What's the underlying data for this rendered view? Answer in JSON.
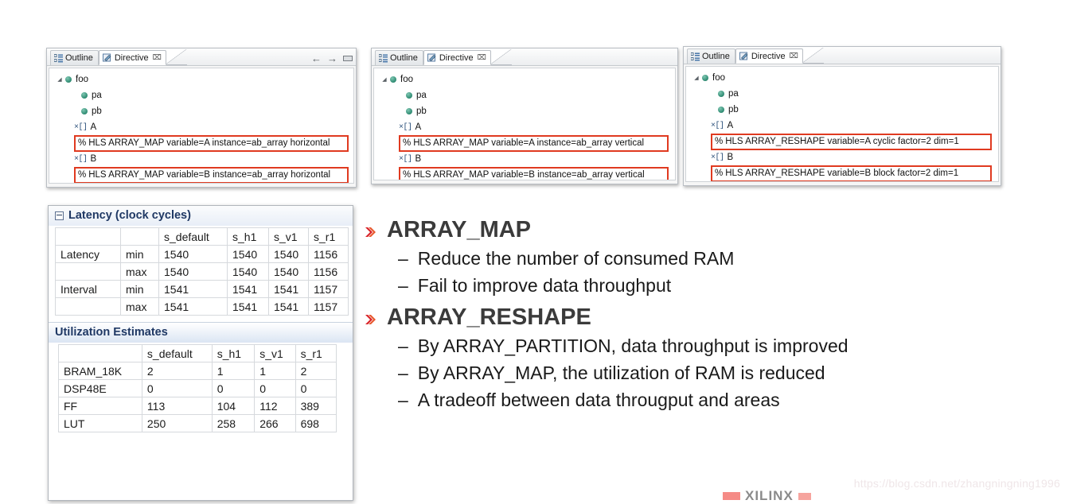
{
  "panels": [
    {
      "id": "panel-horizontal",
      "tabs": [
        {
          "label": "Outline",
          "icon": "outline-icon",
          "active": false
        },
        {
          "label": "Directive",
          "icon": "directive-icon",
          "active": true,
          "close": "⌧"
        }
      ],
      "tools": {
        "back": "←",
        "forward": "→",
        "minimize": "minimize-icon"
      },
      "show_tools": true,
      "tree": [
        {
          "type": "root",
          "label": "foo",
          "icon": "green-dot-icon",
          "twist": "◢"
        },
        {
          "type": "child",
          "label": "pa",
          "icon": "green-dot-icon"
        },
        {
          "type": "child",
          "label": "pb",
          "icon": "green-dot-icon"
        },
        {
          "type": "array",
          "label": "A",
          "icon": "array-icon"
        },
        {
          "type": "directive",
          "label": "HLS ARRAY_MAP variable=A instance=ab_array horizontal",
          "prefix": "%"
        },
        {
          "type": "array",
          "label": "B",
          "icon": "array-icon"
        },
        {
          "type": "directive",
          "label": "HLS ARRAY_MAP variable=B instance=ab_array horizontal",
          "prefix": "%"
        }
      ]
    },
    {
      "id": "panel-vertical",
      "tabs": [
        {
          "label": "Outline",
          "icon": "outline-icon",
          "active": false
        },
        {
          "label": "Directive",
          "icon": "directive-icon",
          "active": true,
          "close": "⌧"
        }
      ],
      "tools": {
        "back": "←",
        "forward": "→",
        "minimize": "minimize-icon"
      },
      "show_tools": false,
      "tree": [
        {
          "type": "root",
          "label": "foo",
          "icon": "green-dot-icon",
          "twist": "◢"
        },
        {
          "type": "child",
          "label": "pa",
          "icon": "green-dot-icon"
        },
        {
          "type": "child",
          "label": "pb",
          "icon": "green-dot-icon"
        },
        {
          "type": "array",
          "label": "A",
          "icon": "array-icon"
        },
        {
          "type": "directive",
          "label": "HLS ARRAY_MAP variable=A instance=ab_array vertical",
          "prefix": "%"
        },
        {
          "type": "array",
          "label": "B",
          "icon": "array-icon"
        },
        {
          "type": "directive",
          "label": "HLS ARRAY_MAP variable=B instance=ab_array vertical",
          "prefix": "%"
        }
      ]
    },
    {
      "id": "panel-reshape",
      "tabs": [
        {
          "label": "Outline",
          "icon": "outline-icon",
          "active": false
        },
        {
          "label": "Directive",
          "icon": "directive-icon",
          "active": true,
          "close": "⌧"
        }
      ],
      "tools": {
        "back": "←",
        "forward": "→",
        "minimize": "minimize-icon"
      },
      "show_tools": false,
      "tree": [
        {
          "type": "root",
          "label": "foo",
          "icon": "green-dot-icon",
          "twist": "◢"
        },
        {
          "type": "child",
          "label": "pa",
          "icon": "green-dot-icon"
        },
        {
          "type": "child",
          "label": "pb",
          "icon": "green-dot-icon"
        },
        {
          "type": "array",
          "label": "A",
          "icon": "array-icon"
        },
        {
          "type": "directive",
          "label": "HLS ARRAY_RESHAPE variable=A cyclic factor=2 dim=1",
          "prefix": "%"
        },
        {
          "type": "array",
          "label": "B",
          "icon": "array-icon"
        },
        {
          "type": "directive",
          "label": "HLS ARRAY_RESHAPE variable=B block factor=2 dim=1",
          "prefix": "%"
        }
      ]
    }
  ],
  "report": {
    "latency": {
      "title": "Latency (clock cycles)",
      "columns": [
        "",
        "",
        "s_default",
        "s_h1",
        "s_v1",
        "s_r1"
      ],
      "rows": [
        [
          "Latency",
          "min",
          "1540",
          "1540",
          "1540",
          "1156"
        ],
        [
          "",
          "max",
          "1540",
          "1540",
          "1540",
          "1156"
        ],
        [
          "Interval",
          "min",
          "1541",
          "1541",
          "1541",
          "1157"
        ],
        [
          "",
          "max",
          "1541",
          "1541",
          "1541",
          "1157"
        ]
      ]
    },
    "utilization": {
      "title": "Utilization Estimates",
      "columns": [
        "",
        "s_default",
        "s_h1",
        "s_v1",
        "s_r1"
      ],
      "rows": [
        [
          "BRAM_18K",
          "2",
          "1",
          "1",
          "2"
        ],
        [
          "DSP48E",
          "0",
          "0",
          "0",
          "0"
        ],
        [
          "FF",
          "113",
          "104",
          "112",
          "389"
        ],
        [
          "LUT",
          "250",
          "258",
          "266",
          "698"
        ]
      ]
    }
  },
  "bullets": [
    {
      "title": "ARRAY_MAP",
      "items": [
        "Reduce the number of consumed RAM",
        "Fail to improve data throughput"
      ]
    },
    {
      "title": "ARRAY_RESHAPE",
      "items": [
        "By ARRAY_PARTITION, data throughput is improved",
        "By ARRAY_MAP, the utilization of RAM is reduced",
        "A tradeoff between data througput and areas"
      ]
    }
  ],
  "watermark": "https://blog.csdn.net/zhangningning1996",
  "logo": {
    "text": "XILINX"
  },
  "colors": {
    "accent_red": "#e03a20",
    "heading_blue": "#1f3864",
    "bullet_red": "#d81f26",
    "tree_green": "#2e8b72"
  }
}
